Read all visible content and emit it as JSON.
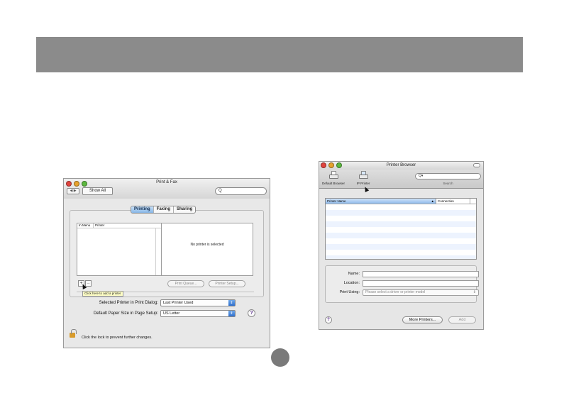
{
  "print_fax": {
    "title": "Print & Fax",
    "nav_arrows": "◀ ▶",
    "show_all": "Show All",
    "search_icon": "Q",
    "tabs": [
      {
        "label": "Printing",
        "active": true
      },
      {
        "label": "Faxing",
        "active": false
      },
      {
        "label": "Sharing",
        "active": false
      }
    ],
    "list_columns": [
      "In Menu",
      "Printer"
    ],
    "no_printer": "No printer is selected",
    "add_symbol": "+",
    "remove_symbol": "–",
    "tooltip": "Click here to add a printer",
    "print_queue": "Print Queue...",
    "printer_setup": "Printer Setup...",
    "selected_printer_label": "Selected Printer in Print Dialog:",
    "selected_printer_value": "Last Printer Used",
    "paper_size_label": "Default Paper Size in Page Setup:",
    "paper_size_value": "US Letter",
    "help": "?",
    "lock_text": "Click the lock to prevent further changes."
  },
  "printer_browser": {
    "title": "Printer Browser",
    "toolbar": [
      {
        "label": "Default Browser",
        "icon": "printer-magnifier-icon"
      },
      {
        "label": "IP Printer",
        "icon": "printer-globe-icon"
      }
    ],
    "search_icon": "Q▾",
    "search_label": "Search",
    "columns": [
      "Printer Name",
      "Connection"
    ],
    "sort_indicator": "▲",
    "name_label": "Name:",
    "location_label": "Location:",
    "print_using_label": "Print Using:",
    "print_using_value": "Please select a driver or printer model",
    "help": "?",
    "more_printers": "More Printers...",
    "add": "Add"
  },
  "colors": {
    "banner": "#8b8b8b",
    "accent_blue": "#2f6fcd",
    "page_circle": "#7a7a7a"
  }
}
